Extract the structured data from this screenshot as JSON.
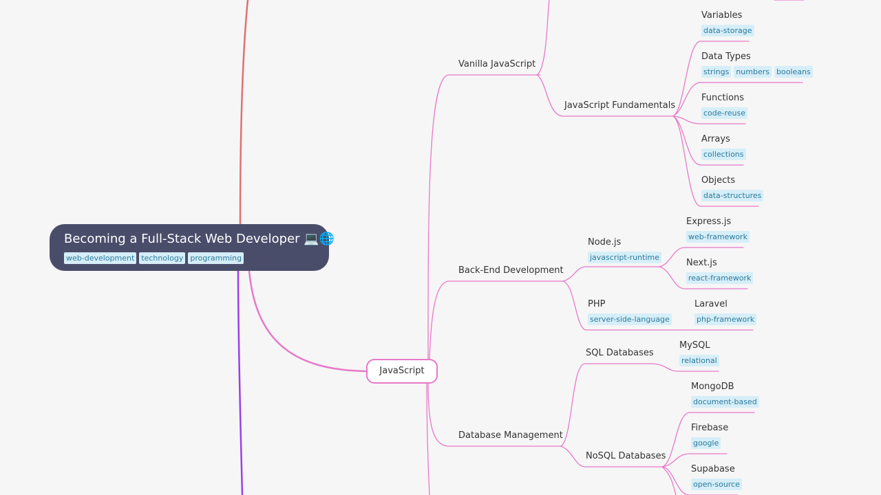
{
  "root": {
    "title": "Becoming a Full-Stack Web Developer",
    "emoji": "💻🌐",
    "tags": [
      "web-development",
      "technology",
      "programming"
    ]
  },
  "colors": {
    "root_bg": "#4a4d6a",
    "branch_pink": "#e878c8",
    "branch_red": "#e07070",
    "branch_purple": "#9b3fe8",
    "tag_bg": "#d6eef8",
    "tag_text": "#2c7a9c"
  },
  "js": {
    "label": "JavaScript"
  },
  "nodes": {
    "vanilla": {
      "label": "Vanilla JavaScript"
    },
    "fundamentals": {
      "label": "JavaScript Fundamentals"
    },
    "variables": {
      "label": "Variables",
      "tags": [
        "data-storage"
      ]
    },
    "datatypes": {
      "label": "Data Types",
      "tags": [
        "strings",
        "numbers",
        "booleans"
      ]
    },
    "functions": {
      "label": "Functions",
      "tags": [
        "code-reuse"
      ]
    },
    "arrays": {
      "label": "Arrays",
      "tags": [
        "collections"
      ]
    },
    "objects": {
      "label": "Objects",
      "tags": [
        "data-structures"
      ]
    },
    "backend": {
      "label": "Back-End Development"
    },
    "nodejs": {
      "label": "Node.js",
      "tags": [
        "javascript-runtime"
      ]
    },
    "express": {
      "label": "Express.js",
      "tags": [
        "web-framework"
      ]
    },
    "nextjs": {
      "label": "Next.js",
      "tags": [
        "react-framework"
      ]
    },
    "php": {
      "label": "PHP",
      "tags": [
        "server-side-language"
      ]
    },
    "laravel": {
      "label": "Laravel",
      "tags": [
        "php-framework"
      ]
    },
    "dbm": {
      "label": "Database Management"
    },
    "sql": {
      "label": "SQL Databases"
    },
    "mysql": {
      "label": "MySQL",
      "tags": [
        "relational"
      ]
    },
    "nosql": {
      "label": "NoSQL Databases"
    },
    "mongodb": {
      "label": "MongoDB",
      "tags": [
        "document-based"
      ]
    },
    "firebase": {
      "label": "Firebase",
      "tags": [
        "google"
      ]
    },
    "supabase": {
      "label": "Supabase",
      "tags": [
        "open-source"
      ]
    }
  }
}
